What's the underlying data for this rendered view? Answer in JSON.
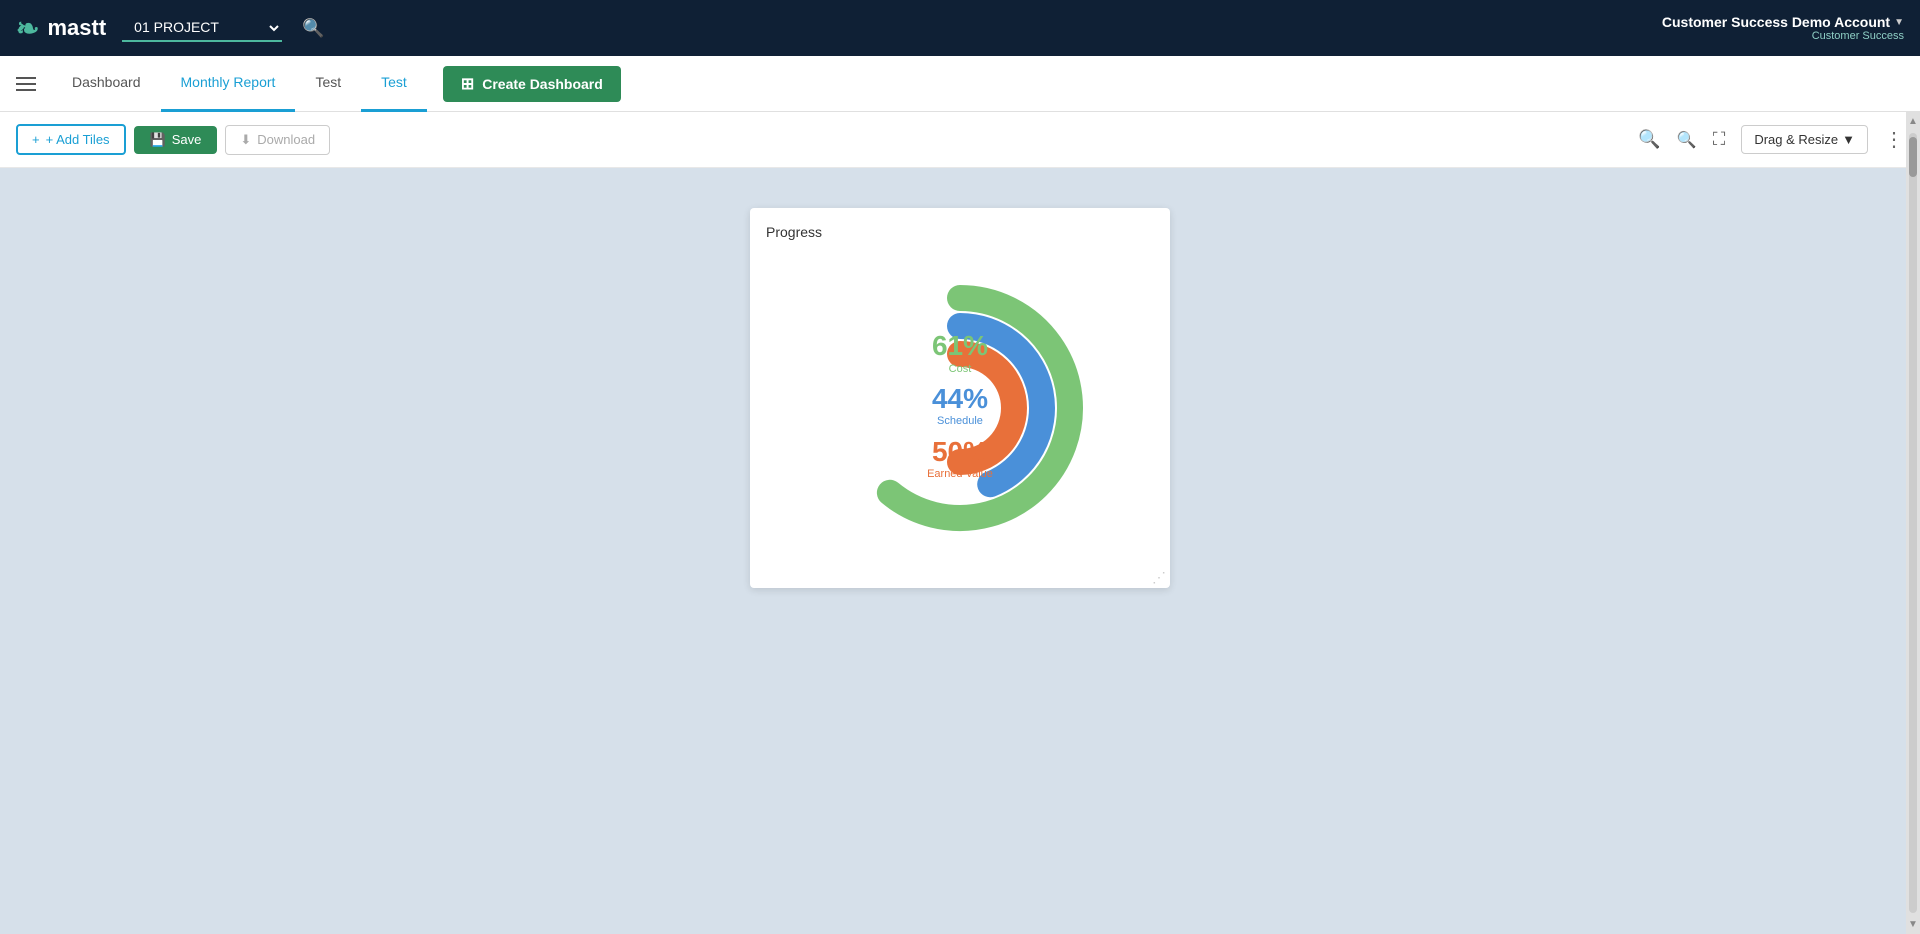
{
  "topNav": {
    "logoText": "mastt",
    "projectLabel": "01 PROJECT",
    "accountName": "Customer Success Demo Account",
    "accountSub": "Customer Success"
  },
  "tabs": [
    {
      "id": "dashboard",
      "label": "Dashboard",
      "active": false
    },
    {
      "id": "monthly-report",
      "label": "Monthly Report",
      "active": false
    },
    {
      "id": "test1",
      "label": "Test",
      "active": false
    },
    {
      "id": "test2",
      "label": "Test",
      "active": true
    }
  ],
  "createDashboardBtn": "Create Dashboard",
  "toolbar": {
    "addTilesLabel": "+ Add Tiles",
    "saveLabel": "Save",
    "downloadLabel": "Download",
    "dragResizeLabel": "Drag & Resize"
  },
  "chart": {
    "title": "Progress",
    "arcs": [
      {
        "id": "cost",
        "color": "#7cc576",
        "pct": 61,
        "label": "Cost",
        "labelColor": "#7cc576",
        "pctColor": "#7cc576"
      },
      {
        "id": "schedule",
        "color": "#4a90d9",
        "pct": 44,
        "label": "Schedule",
        "labelColor": "#4a90d9",
        "pctColor": "#4a90d9"
      },
      {
        "id": "earned-value",
        "color": "#e8703a",
        "pct": 50,
        "label": "Earned Value",
        "labelColor": "#e8703a",
        "pctColor": "#e8703a"
      }
    ]
  }
}
